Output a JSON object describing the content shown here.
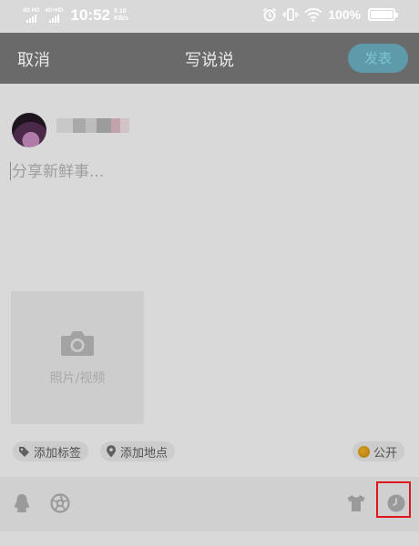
{
  "status_bar": {
    "network1": "4G HD",
    "network2": "4G+HD",
    "time": "10:52",
    "speed_value": "0.10",
    "speed_unit": "KB/s",
    "battery_pct": "100%",
    "icons": [
      "alarm-icon",
      "vibrate-icon",
      "wifi-icon",
      "battery-icon"
    ]
  },
  "nav": {
    "cancel": "取消",
    "title": "写说说",
    "publish": "发表"
  },
  "compose": {
    "placeholder": "分享新鲜事..."
  },
  "media": {
    "label": "照片/视频",
    "icon": "camera-icon"
  },
  "chips": {
    "tag": "添加标签",
    "location": "添加地点",
    "visibility": "公开"
  },
  "toolbar": {
    "icons": [
      "qq-penguin-icon",
      "shutter-icon",
      "tshirt-icon",
      "clock-icon"
    ]
  },
  "colors": {
    "nav_bg": "#6a6a6a",
    "publish_bg": "#5d9aaa",
    "highlight": "#e0141b",
    "coin": "#c28a16"
  }
}
